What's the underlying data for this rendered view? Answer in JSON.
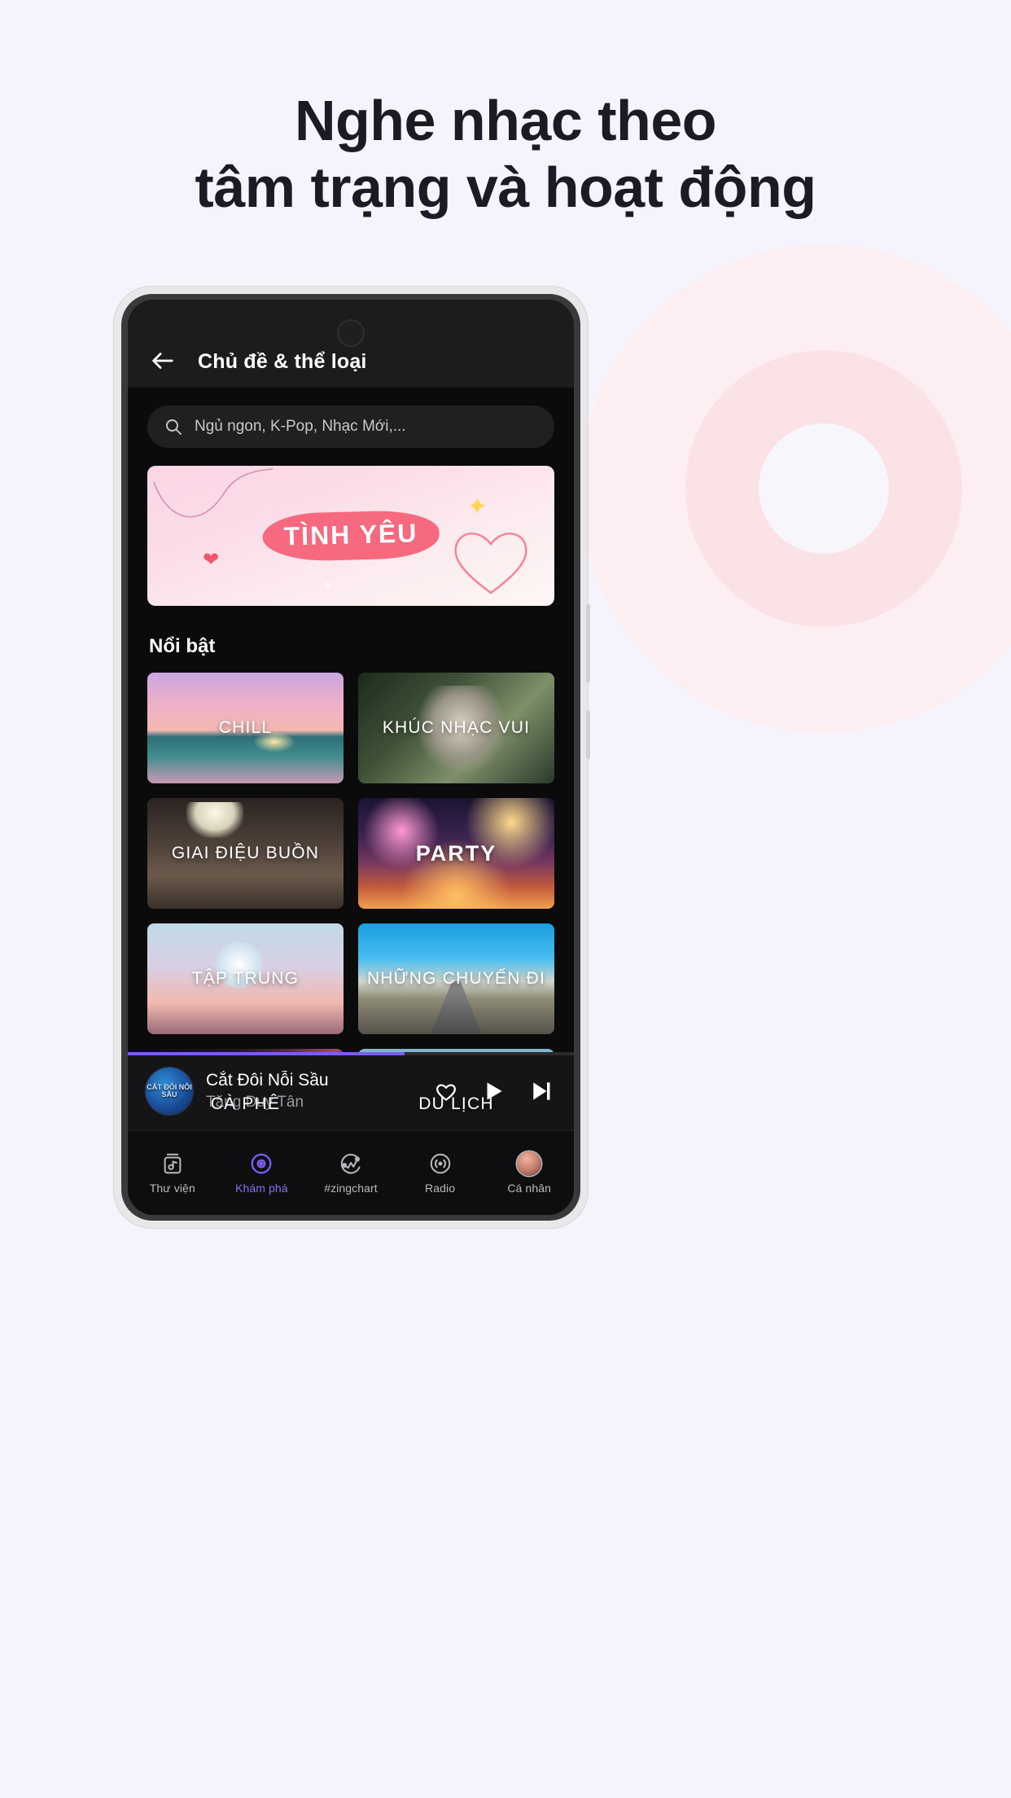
{
  "promo": {
    "headline_line1": "Nghe nhạc theo",
    "headline_line2": "tâm trạng và hoạt động"
  },
  "appbar": {
    "back_icon": "arrow-left-icon",
    "title": "Chủ đề & thể loại"
  },
  "search": {
    "icon": "search-icon",
    "placeholder": "Ngủ ngon, K-Pop, Nhạc Mới,..."
  },
  "banner": {
    "label": "TÌNH YÊU",
    "sparkle_icon": "sparkle-icon",
    "heart_icon": "heart-icon"
  },
  "section": {
    "title": "Nổi bật"
  },
  "cards": [
    {
      "label": "CHILL",
      "art": "art-chill",
      "big": false
    },
    {
      "label": "KHÚC NHẠC VUI",
      "art": "art-khuc",
      "big": false
    },
    {
      "label": "GIAI ĐIỆU BUỒN",
      "art": "art-buon",
      "big": false
    },
    {
      "label": "PARTY",
      "art": "art-party",
      "big": true
    },
    {
      "label": "TẬP TRUNG",
      "art": "art-tap",
      "big": false
    },
    {
      "label": "NHỮNG CHUYẾN ĐI",
      "art": "art-chuyen",
      "big": false
    },
    {
      "label": "CÀ PHÊ",
      "art": "art-cafe",
      "big": false
    },
    {
      "label": "DU LỊCH",
      "art": "art-dulich",
      "big": false
    }
  ],
  "player": {
    "title": "Cắt Đôi Nỗi Sầu",
    "artist": "Tăng Duy Tân",
    "cover_text": "CẮT ĐÔI NỖI SẦU",
    "progress_percent": 62,
    "like_icon": "heart-outline-icon",
    "play_icon": "play-icon",
    "next_icon": "skip-next-icon",
    "progress_color": "#7b5cf0"
  },
  "tabs": [
    {
      "label": "Thư viện",
      "icon": "library-music-icon",
      "active": false
    },
    {
      "label": "Khám phá",
      "icon": "discover-disc-icon",
      "active": true
    },
    {
      "label": "#zingchart",
      "icon": "chart-circle-icon",
      "active": false
    },
    {
      "label": "Radio",
      "icon": "radio-waves-icon",
      "active": false
    },
    {
      "label": "Cá nhân",
      "icon": "avatar-icon",
      "active": false
    }
  ],
  "theme": {
    "page_background": "#f5f4fc",
    "accent": "#7b5cf0",
    "screen_background": "#0b0b0c",
    "appbar_background": "#1c1c1e"
  }
}
